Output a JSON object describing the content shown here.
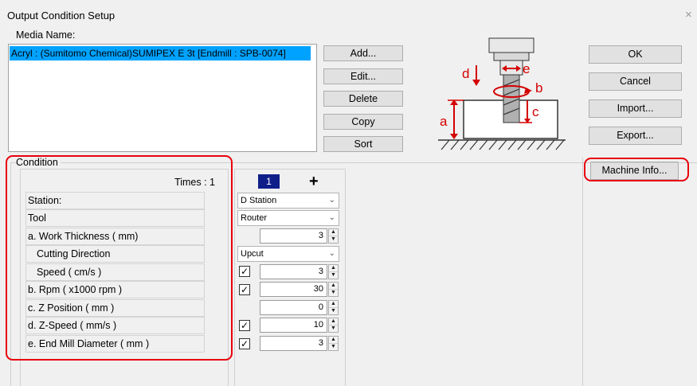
{
  "window": {
    "title": "Output Condition Setup",
    "close_glyph": "×"
  },
  "media": {
    "label": "Media Name:",
    "items": [
      "Acryl : (Sumitomo Chemical)SUMIPEX E 3t [Endmill : SPB-0074]"
    ]
  },
  "media_buttons": {
    "add": "Add...",
    "edit": "Edit...",
    "delete": "Delete",
    "copy": "Copy",
    "sort": "Sort"
  },
  "dialog_buttons": {
    "ok": "OK",
    "cancel": "Cancel",
    "import": "Import...",
    "export": "Export...",
    "machine_info": "Machine Info..."
  },
  "illustration": {
    "label_a": "a",
    "label_b": "b",
    "label_c": "c",
    "label_d": "d",
    "label_e": "e"
  },
  "condition": {
    "label": "Condition",
    "times": "Times : 1",
    "column_number": "1",
    "rows": {
      "station": "Station:",
      "tool": "Tool",
      "work_thickness": "a. Work Thickness ( mm)",
      "cutting_direction": "Cutting Direction",
      "speed": "Speed ( cm/s )",
      "rpm": "b. Rpm ( x1000  rpm )",
      "z_position": "c. Z Position ( mm )",
      "z_speed": "d. Z-Speed ( mm/s )",
      "end_mill_diameter": "e. End Mill Diameter ( mm )"
    },
    "values": {
      "station": "D Station",
      "tool": "Router",
      "work_thickness": "3",
      "cutting_direction": "Upcut",
      "speed": "3",
      "rpm": "30",
      "z_position": "0",
      "z_speed": "10",
      "end_mill_diameter": "3"
    },
    "checkbox_mark": "✓"
  },
  "colors": {
    "selection": "#00a2ff",
    "highlight": "#e8000b",
    "column_badge": "#0f1f8a",
    "illustration_red": "#d40000"
  }
}
